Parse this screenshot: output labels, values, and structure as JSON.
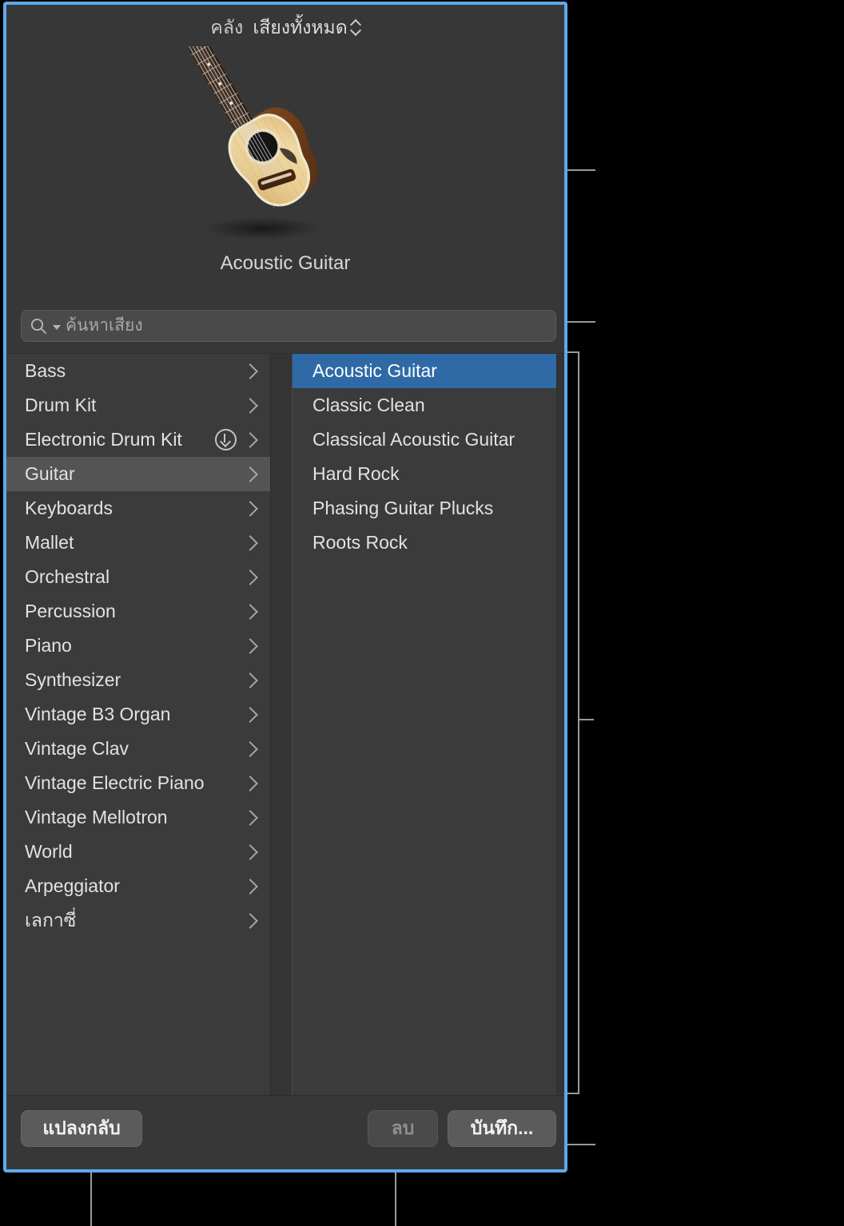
{
  "window": {
    "accent_border_color": "#5fa8ea",
    "background_color": "#373737"
  },
  "header": {
    "library_label": "คลัง",
    "scope_value": "เสียงทั้งหมด",
    "scope_icon": "updown-chevron-icon"
  },
  "preview": {
    "artwork_icon": "acoustic-guitar-image",
    "instrument_name": "Acoustic Guitar"
  },
  "search": {
    "icon": "search-icon",
    "chevron_icon": "chevron-down-icon",
    "value": "",
    "placeholder": "ค้นหาเสียง"
  },
  "browser": {
    "categories": [
      {
        "label": "Bass",
        "selected": false,
        "download": false
      },
      {
        "label": "Drum Kit",
        "selected": false,
        "download": false
      },
      {
        "label": "Electronic Drum Kit",
        "selected": false,
        "download": true
      },
      {
        "label": "Guitar",
        "selected": true,
        "download": false
      },
      {
        "label": "Keyboards",
        "selected": false,
        "download": false
      },
      {
        "label": "Mallet",
        "selected": false,
        "download": false
      },
      {
        "label": "Orchestral",
        "selected": false,
        "download": false
      },
      {
        "label": "Percussion",
        "selected": false,
        "download": false
      },
      {
        "label": "Piano",
        "selected": false,
        "download": false
      },
      {
        "label": "Synthesizer",
        "selected": false,
        "download": false
      },
      {
        "label": "Vintage B3 Organ",
        "selected": false,
        "download": false
      },
      {
        "label": "Vintage Clav",
        "selected": false,
        "download": false
      },
      {
        "label": "Vintage Electric Piano",
        "selected": false,
        "download": false
      },
      {
        "label": "Vintage Mellotron",
        "selected": false,
        "download": false
      },
      {
        "label": "World",
        "selected": false,
        "download": false
      },
      {
        "label": "Arpeggiator",
        "selected": false,
        "download": false
      },
      {
        "label": "เลกาซี่",
        "selected": false,
        "download": false
      }
    ],
    "presets": [
      {
        "label": "Acoustic Guitar",
        "selected": true
      },
      {
        "label": "Classic Clean",
        "selected": false
      },
      {
        "label": "Classical Acoustic Guitar",
        "selected": false
      },
      {
        "label": "Hard Rock",
        "selected": false
      },
      {
        "label": "Phasing Guitar Plucks",
        "selected": false
      },
      {
        "label": "Roots Rock",
        "selected": false
      }
    ],
    "selection_color": "#2f6aa7",
    "highlight_color": "#545454"
  },
  "footer": {
    "revert_label": "แปลงกลับ",
    "delete_label": "ลบ",
    "save_label": "บันทึก...",
    "delete_enabled": false
  },
  "callouts": {
    "line_color": "#9a9a9a",
    "targets": [
      "instrument-artwork",
      "sound-search-field",
      "browser-columns",
      "save-button",
      "delete-button",
      "revert-button"
    ]
  }
}
